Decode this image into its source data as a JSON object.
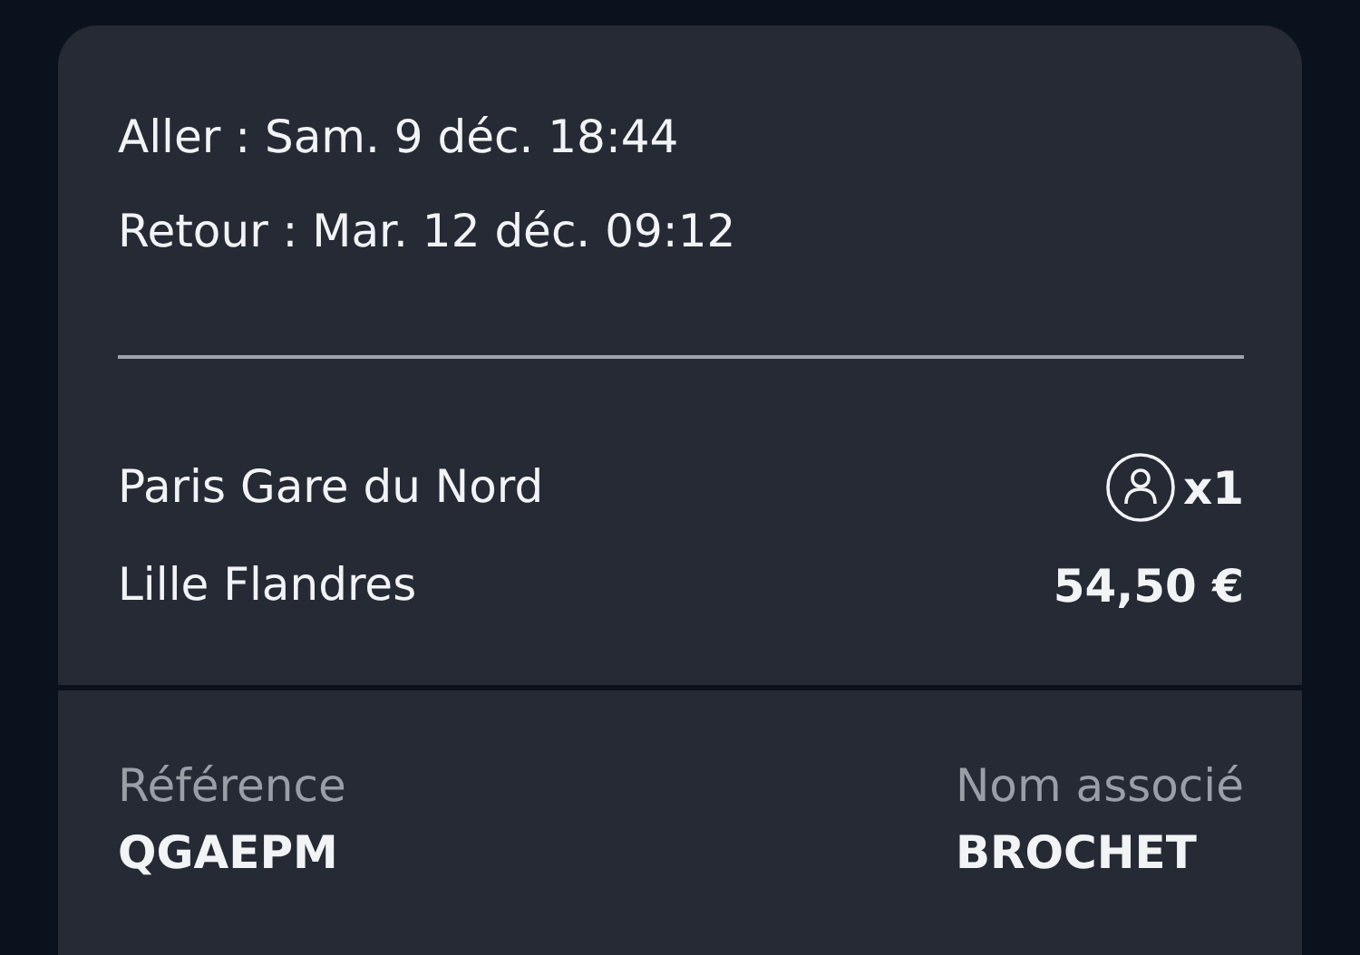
{
  "schedule": [
    {
      "label": "Aller : Sam. 9 déc. 18:44"
    },
    {
      "label": "Retour : Mar. 12 déc. 09:12"
    }
  ],
  "trip": {
    "origin": "Paris Gare du Nord",
    "destination": "Lille Flandres",
    "passengers": "x1",
    "price": "54,50 €"
  },
  "booking": [
    {
      "label": "Référence",
      "value": "QGAEPM"
    },
    {
      "label": "Nom associé",
      "value": "BROCHET"
    }
  ]
}
